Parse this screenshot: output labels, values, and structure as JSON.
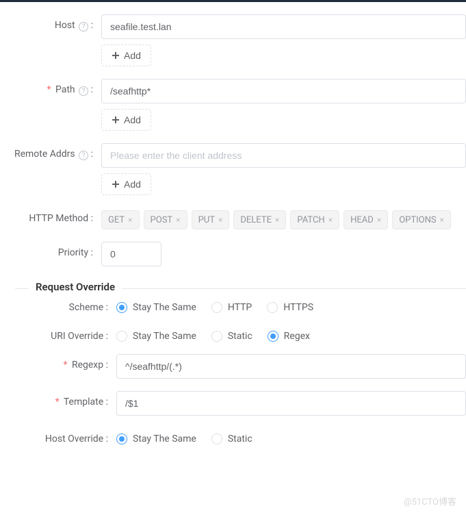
{
  "fields": {
    "host": {
      "label": "Host",
      "value": "seafile.test.lan",
      "add": "Add"
    },
    "path": {
      "label": "Path",
      "value": "/seafhttp*",
      "add": "Add"
    },
    "remoteAddrs": {
      "label": "Remote Addrs",
      "placeholder": "Please enter the client address",
      "add": "Add"
    },
    "httpMethod": {
      "label": "HTTP Method",
      "tags": [
        "GET",
        "POST",
        "PUT",
        "DELETE",
        "PATCH",
        "HEAD",
        "OPTIONS"
      ]
    },
    "priority": {
      "label": "Priority",
      "value": "0"
    }
  },
  "override": {
    "section": "Request Override",
    "scheme": {
      "label": "Scheme",
      "options": [
        "Stay The Same",
        "HTTP",
        "HTTPS"
      ],
      "selected": "Stay The Same"
    },
    "uriOverride": {
      "label": "URI Override",
      "options": [
        "Stay The Same",
        "Static",
        "Regex"
      ],
      "selected": "Regex"
    },
    "regexp": {
      "label": "Regexp",
      "value": "^/seafhttp/(.*)"
    },
    "template": {
      "label": "Template",
      "value": "/$1"
    },
    "hostOverride": {
      "label": "Host Override",
      "options": [
        "Stay The Same",
        "Static"
      ],
      "selected": "Stay The Same"
    }
  },
  "watermark": "@51CTO博客"
}
